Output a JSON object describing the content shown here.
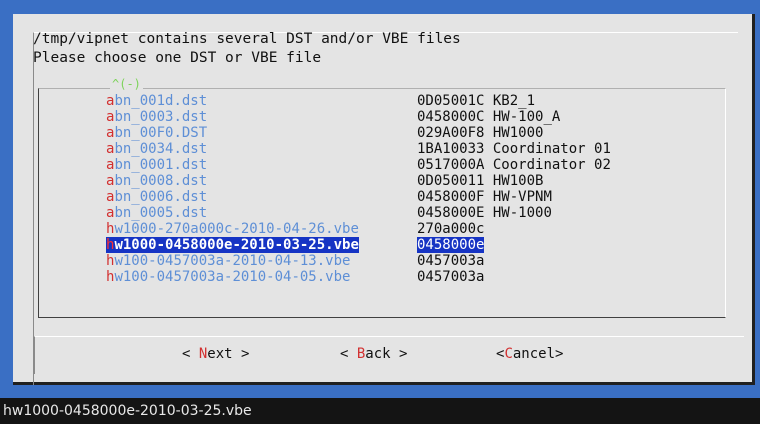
{
  "prompt": {
    "line1": "/tmp/vipnet contains several DST and/or VBE files",
    "line2": "Please choose one DST or VBE file"
  },
  "scroll_indicator": "^(-)",
  "items": [
    {
      "first": "a",
      "rest": "bn_001d.dst",
      "code": "0D05001C",
      "desc": "KB2_1",
      "selected": false
    },
    {
      "first": "a",
      "rest": "bn_0003.dst",
      "code": "0458000C",
      "desc": "HW-100_A",
      "selected": false
    },
    {
      "first": "a",
      "rest": "bn_00F0.DST",
      "code": "029A00F8",
      "desc": "HW1000",
      "selected": false
    },
    {
      "first": "a",
      "rest": "bn_0034.dst",
      "code": "1BA10033",
      "desc": "Coordinator 01",
      "selected": false
    },
    {
      "first": "a",
      "rest": "bn_0001.dst",
      "code": "0517000A",
      "desc": "Coordinator 02",
      "selected": false
    },
    {
      "first": "a",
      "rest": "bn_0008.dst",
      "code": "0D050011",
      "desc": "HW100B",
      "selected": false
    },
    {
      "first": "a",
      "rest": "bn_0006.dst",
      "code": "0458000F",
      "desc": "HW-VPNM",
      "selected": false
    },
    {
      "first": "a",
      "rest": "bn_0005.dst",
      "code": "0458000E",
      "desc": "HW-1000",
      "selected": false
    },
    {
      "first": "h",
      "rest": "w1000-270a000c-2010-04-26.vbe",
      "code": "270a000c",
      "desc": "",
      "selected": false
    },
    {
      "first": "h",
      "rest": "w1000-0458000e-2010-03-25.vbe",
      "code": "0458000e",
      "desc": "",
      "selected": true
    },
    {
      "first": "h",
      "rest": "w100-0457003a-2010-04-13.vbe",
      "code": "0457003a",
      "desc": "",
      "selected": false
    },
    {
      "first": "h",
      "rest": "w100-0457003a-2010-04-05.vbe",
      "code": "0457003a",
      "desc": "",
      "selected": false
    }
  ],
  "buttons": {
    "next": {
      "pre": "< ",
      "hot": "N",
      "post": "ext >"
    },
    "back": {
      "pre": "< ",
      "hot": "B",
      "post": "ack >"
    },
    "cancel": {
      "pre": "<",
      "hot": "C",
      "post": "ancel>"
    }
  },
  "status_text": "hw1000-0458000e-2010-03-25.vbe"
}
